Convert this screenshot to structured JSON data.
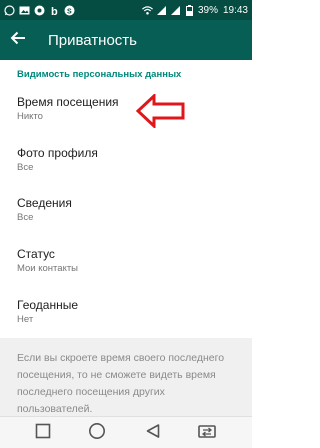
{
  "status_bar": {
    "battery": "39%",
    "time": "19:43",
    "icons": [
      "whatsapp-icon",
      "image-icon",
      "camera-icon",
      "b-icon",
      "skype-icon",
      "wifi-icon",
      "sim1-signal-icon",
      "sim2-signal-icon",
      "battery-icon"
    ]
  },
  "toolbar": {
    "title": "Приватность",
    "back_icon": "arrow-back-icon"
  },
  "section": {
    "header": "Видимость персональных данных",
    "items": [
      {
        "title": "Время посещения",
        "value": "Никто"
      },
      {
        "title": "Фото профиля",
        "value": "Все"
      },
      {
        "title": "Сведения",
        "value": "Все"
      },
      {
        "title": "Статус",
        "value": "Мои контакты"
      },
      {
        "title": "Геоданные",
        "value": "Нет"
      }
    ]
  },
  "note": {
    "text": "Если вы скроете время своего последнего посещения, то не сможете видеть время последнего посещения других пользователей."
  },
  "annotation": {
    "color": "#e0161b"
  },
  "nav_bar": {
    "buttons": [
      "square-icon",
      "circle-icon",
      "triangle-back-icon",
      "swap-sim-icon"
    ]
  }
}
